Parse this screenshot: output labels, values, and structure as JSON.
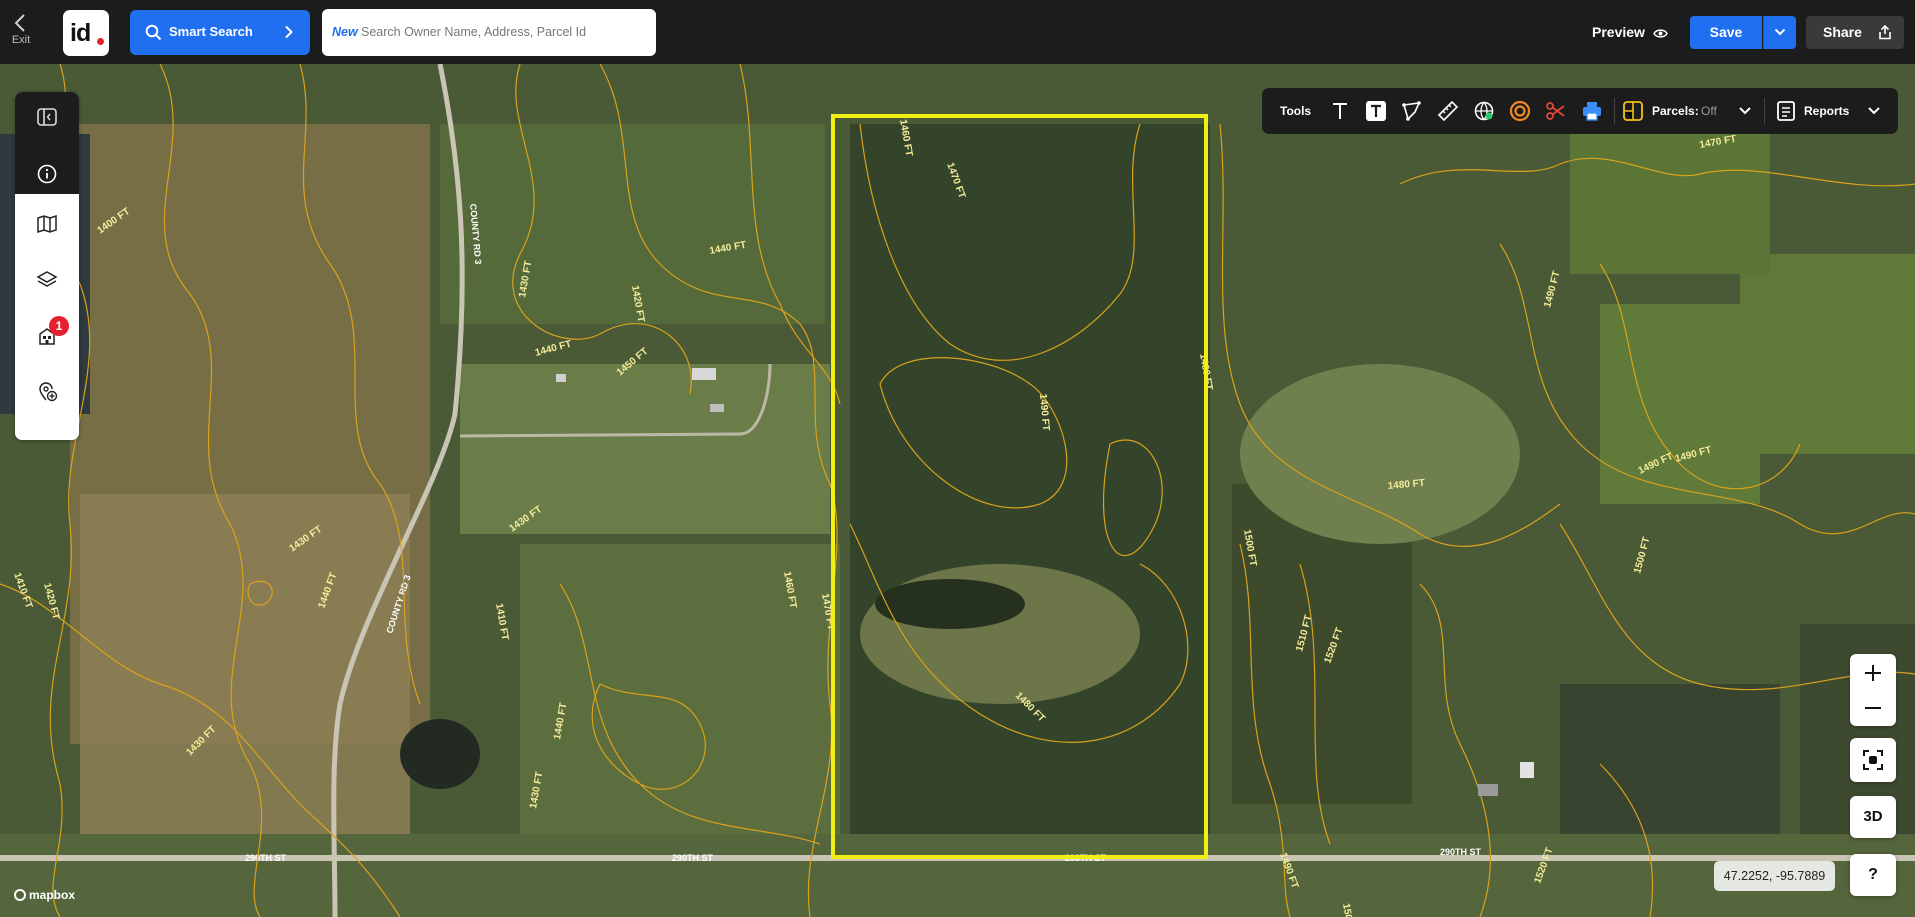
{
  "header": {
    "exit_label": "Exit",
    "logo_text": "id",
    "smart_search_label": "Smart Search",
    "search_new_tag": "New",
    "search_placeholder": "Search Owner Name, Address, Parcel Id",
    "preview_label": "Preview",
    "save_label": "Save",
    "share_label": "Share"
  },
  "left_toolbar": {
    "items": [
      {
        "name": "panel-toggle-icon"
      },
      {
        "name": "info-icon"
      },
      {
        "name": "map-icon"
      },
      {
        "name": "layers-icon"
      },
      {
        "name": "buildings-icon",
        "badge": "1"
      },
      {
        "name": "add-location-icon"
      }
    ]
  },
  "tools_bar": {
    "label": "Tools",
    "icons": [
      "text-icon",
      "text-box-icon",
      "polygon-icon",
      "ruler-icon",
      "globe-icon",
      "radius-icon",
      "scissors-icon",
      "print-icon"
    ],
    "parcels_label": "Parcels:",
    "parcels_value": "Off",
    "reports_label": "Reports"
  },
  "map": {
    "contour_labels": [
      "1400 FT",
      "1440 FT",
      "1430 FT",
      "1420 FT",
      "1440 FT",
      "1450 FT",
      "1430 FT",
      "1430 FT",
      "1440 FT",
      "1410 FT",
      "1420 FT",
      "1410 FT",
      "1430 FT",
      "1440 FT",
      "1430 FT",
      "1460 FT",
      "1470 FT",
      "1460 FT",
      "1470 FT",
      "1490 FT",
      "1480 FT",
      "1480 FT",
      "1480 FT",
      "1490 FT",
      "1490 FT",
      "1500 FT",
      "1510 FT",
      "1520 FT",
      "1490 FT",
      "1500 FT",
      "1470 FT",
      "1490 FT",
      "1520 FT",
      "1500 FT"
    ],
    "road_labels": [
      "COUNTY RD 3",
      "COUNTY RD 3",
      "290TH ST",
      "290TH ST",
      "290TH ST",
      "290TH ST"
    ],
    "boundary_color": "#f2ef14",
    "contour_color": "#d9a21b"
  },
  "controls": {
    "zoom_in": "+",
    "zoom_out": "−",
    "three_d_label": "3D",
    "help_label": "?",
    "coordinates": "47.2252, -95.7889",
    "attribution": "mapbox"
  }
}
